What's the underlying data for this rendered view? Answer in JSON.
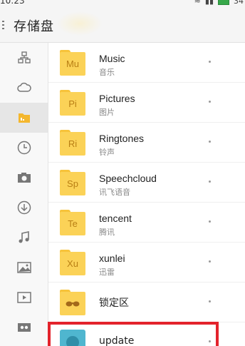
{
  "status_bar": {
    "time": "10:23",
    "battery": "34"
  },
  "title_bar": {
    "title": "存储盘"
  },
  "sidebar": {
    "items": [
      {
        "icon": "sitemap-icon"
      },
      {
        "icon": "cloud-icon"
      },
      {
        "icon": "storage-icon",
        "active": true
      },
      {
        "icon": "clock-icon"
      },
      {
        "icon": "camera-icon"
      },
      {
        "icon": "download-icon"
      },
      {
        "icon": "music-icon"
      },
      {
        "icon": "image-icon"
      },
      {
        "icon": "video-icon"
      },
      {
        "icon": "vault-icon"
      }
    ]
  },
  "files": [
    {
      "badge": "Mu",
      "name": "Music",
      "subtitle": "音乐"
    },
    {
      "badge": "Pi",
      "name": "Pictures",
      "subtitle": "图片"
    },
    {
      "badge": "Ri",
      "name": "Ringtones",
      "subtitle": "铃声"
    },
    {
      "badge": "Sp",
      "name": "Speechcloud",
      "subtitle": "讯飞语音"
    },
    {
      "badge": "Te",
      "name": "tencent",
      "subtitle": "腾讯"
    },
    {
      "badge": "Xu",
      "name": "xunlei",
      "subtitle": "迅雷"
    },
    {
      "badge": "",
      "name": "锁定区",
      "subtitle": "",
      "icon": "glasses-icon"
    },
    {
      "badge": "",
      "name": "update",
      "subtitle": "",
      "icon": "update-icon"
    }
  ],
  "colors": {
    "folder": "#fbd257",
    "folder_text": "#b97f14",
    "highlight": "#e3232c",
    "update_icon": "#4fb6cf"
  }
}
